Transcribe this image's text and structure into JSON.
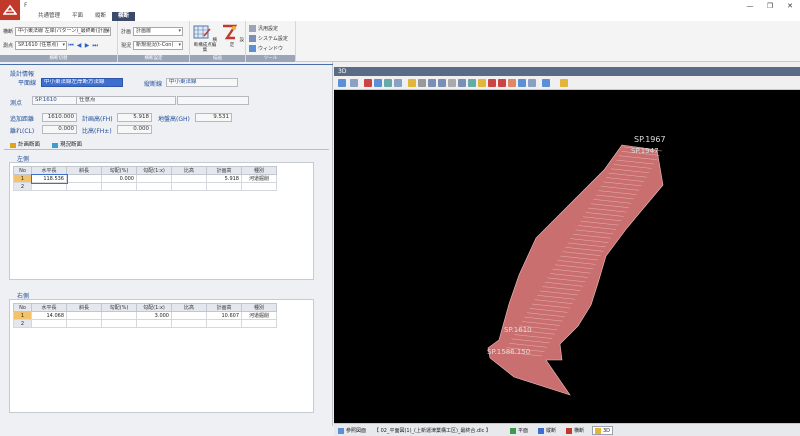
{
  "window": {
    "title": "F",
    "minimize": "—",
    "maximize": "❐",
    "close": "✕"
  },
  "ribbon_tabs": [
    "",
    "共通管理",
    "平面",
    "縦断",
    "横断"
  ],
  "ribbon": {
    "group1": {
      "label": "横断切替",
      "row1_label": "横断",
      "row1_value": "中小東法線 左岸(パターン)_最終断(計画)",
      "row2_label": "測点",
      "row2_value": "SP.1610 (任意点)"
    },
    "group2": {
      "label": "横断設定",
      "row1_label": "計画",
      "row1_value": "計画層",
      "row2_label": "現況",
      "row2_value": "新規現況(t-Con)"
    },
    "group3": {
      "label": "描画",
      "btn1": "横断構成点編集",
      "btn2": "設定"
    },
    "group4": {
      "label": "ツール",
      "item1": "汎用設定",
      "item2": "システム設定",
      "item3": "ウィンドウ"
    }
  },
  "design_info": {
    "title": "設計情報",
    "plan_line_label": "平面線",
    "plan_line_value": "中小東法線左岸断方法線",
    "profile_line_label": "縦断線",
    "profile_line_value": "中小東法線",
    "station_label": "測点",
    "station_value": "SP.1610",
    "station_type": "任意点",
    "add_dist_label": "追加距離",
    "add_dist_value": "1610.000",
    "plan_height_label": "計画高(FH)",
    "plan_height_value": "5.918",
    "ground_height_label": "地盤高(GH)",
    "ground_height_value": "9.531",
    "offset_label": "離れ(CL)",
    "offset_value": "0.000",
    "ratio_label": "比高(FH±)",
    "ratio_value": "0.000"
  },
  "sub_tabs": {
    "plan": "計画断面",
    "current": "現況断面"
  },
  "columns": [
    "No",
    "水平長",
    "斜長",
    "勾配(%)",
    "勾配(1:x)",
    "比高",
    "計画高",
    "種別"
  ],
  "left_side": {
    "title": "左側",
    "rows": [
      [
        "1",
        "118.536",
        "",
        "0.000",
        "",
        "",
        "5.918",
        "河道掘削"
      ],
      [
        "2",
        "",
        "",
        "",
        "",
        "",
        "",
        ""
      ]
    ]
  },
  "right_side": {
    "title": "右側",
    "rows": [
      [
        "1",
        "14.068",
        "",
        "",
        "3.000",
        "",
        "10.607",
        "河道掘削"
      ],
      [
        "2",
        "",
        "",
        "",
        "",
        "",
        "",
        ""
      ]
    ]
  },
  "panel3d": {
    "title": "3D",
    "labels": {
      "top": "SP.1967",
      "top2": "SP.1947",
      "mid": "SP.1610",
      "bottom": "SP.1586.150"
    }
  },
  "statusbar": {
    "ref_label": "参照図面",
    "ref_value": "【 02_平面図(1)_(上新運津業構工区)_最終合.dlc 】",
    "items": [
      "平面",
      "縦断",
      "横断",
      "3D"
    ]
  },
  "colors": {
    "ribbon_accent": "#3b4a6b",
    "selection": "#3d6fd0",
    "mesh_fill": "#c96f6f",
    "mesh_edge": "#f2c2c2"
  }
}
